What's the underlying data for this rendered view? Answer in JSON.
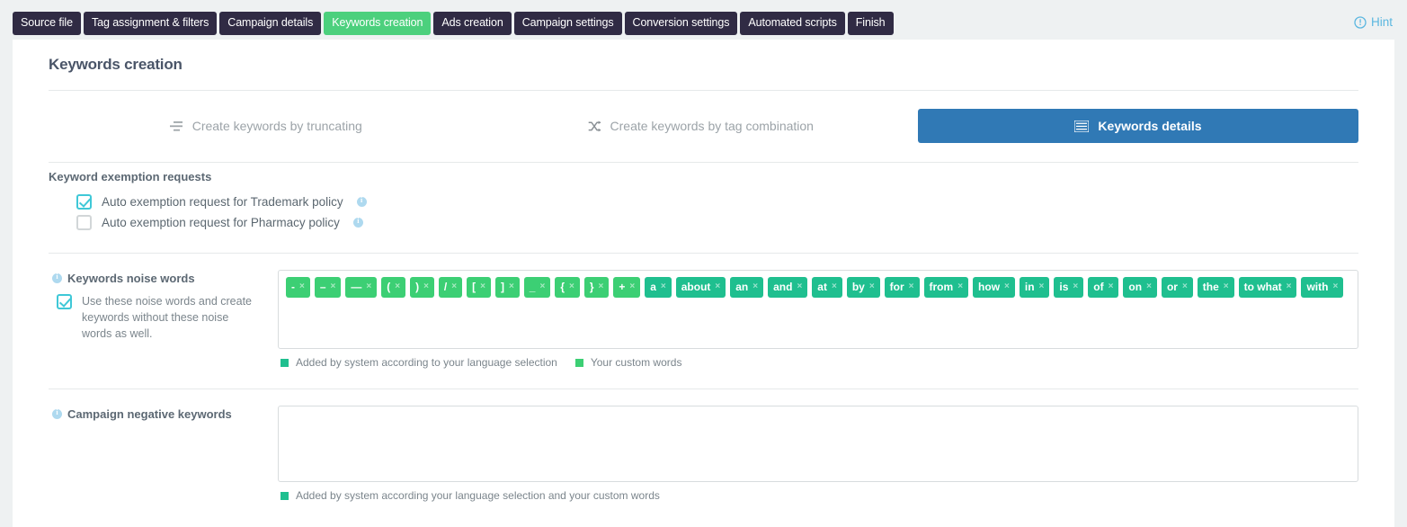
{
  "wizard": {
    "steps": [
      {
        "label": "Source file",
        "active": false
      },
      {
        "label": "Tag assignment & filters",
        "active": false
      },
      {
        "label": "Campaign details",
        "active": false
      },
      {
        "label": "Keywords creation",
        "active": true
      },
      {
        "label": "Ads creation",
        "active": false
      },
      {
        "label": "Campaign settings",
        "active": false
      },
      {
        "label": "Conversion settings",
        "active": false
      },
      {
        "label": "Automated scripts",
        "active": false
      },
      {
        "label": "Finish",
        "active": false
      }
    ],
    "hint_label": "Hint",
    "active_color": "#4cd07d",
    "step_color": "#302b44",
    "hint_color": "#5bb7e0"
  },
  "page": {
    "title": "Keywords creation"
  },
  "modes": {
    "truncating_label": "Create keywords by truncating",
    "tag_combination_label": "Create keywords by tag combination",
    "details_label": "Keywords details",
    "active_bg": "#3079b5"
  },
  "exemption": {
    "title": "Keyword exemption requests",
    "items": [
      {
        "label": "Auto exemption request for Trademark policy",
        "checked": true
      },
      {
        "label": "Auto exemption request for Pharmacy policy",
        "checked": false
      }
    ]
  },
  "noise": {
    "label": "Keywords noise words",
    "checkbox_text": "Use these noise words and create keywords without these noise words as well.",
    "checked": true,
    "tags": [
      {
        "text": "-",
        "type": "custom"
      },
      {
        "text": "–",
        "type": "custom"
      },
      {
        "text": "—",
        "type": "custom"
      },
      {
        "text": "(",
        "type": "custom"
      },
      {
        "text": ")",
        "type": "custom"
      },
      {
        "text": "/",
        "type": "custom"
      },
      {
        "text": "[",
        "type": "custom"
      },
      {
        "text": "]",
        "type": "custom"
      },
      {
        "text": "_",
        "type": "custom"
      },
      {
        "text": "{",
        "type": "custom"
      },
      {
        "text": "}",
        "type": "custom"
      },
      {
        "text": "+",
        "type": "custom"
      },
      {
        "text": "a",
        "type": "sys"
      },
      {
        "text": "about",
        "type": "sys"
      },
      {
        "text": "an",
        "type": "sys"
      },
      {
        "text": "and",
        "type": "sys"
      },
      {
        "text": "at",
        "type": "sys"
      },
      {
        "text": "by",
        "type": "sys"
      },
      {
        "text": "for",
        "type": "sys"
      },
      {
        "text": "from",
        "type": "sys"
      },
      {
        "text": "how",
        "type": "sys"
      },
      {
        "text": "in",
        "type": "sys"
      },
      {
        "text": "is",
        "type": "sys"
      },
      {
        "text": "of",
        "type": "sys"
      },
      {
        "text": "on",
        "type": "sys"
      },
      {
        "text": "or",
        "type": "sys"
      },
      {
        "text": "the",
        "type": "sys"
      },
      {
        "text": "to what",
        "type": "sys"
      },
      {
        "text": "with",
        "type": "sys"
      }
    ],
    "remove_glyph": "×",
    "legend_system": "Added by system according to your language selection",
    "legend_custom": "Your custom words",
    "color_system": "#1fbf8f",
    "color_custom": "#3ccf74"
  },
  "negative": {
    "label": "Campaign negative keywords",
    "value": "",
    "legend": "Added by system according your language selection and your custom words",
    "legend_color": "#1fbf8f"
  }
}
